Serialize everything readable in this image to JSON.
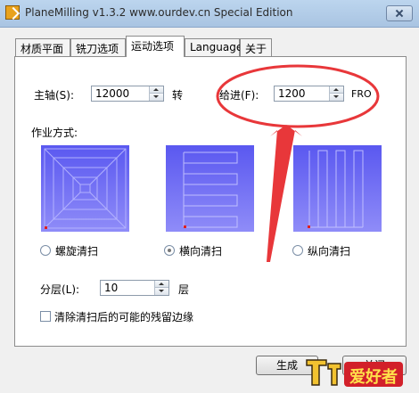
{
  "window": {
    "title": "PlaneMilling v1.3.2 www.ourdev.cn Special Edition"
  },
  "tabs": [
    {
      "label": "材质平面",
      "active": false
    },
    {
      "label": "铣刀选项",
      "active": false
    },
    {
      "label": "运动选项",
      "active": true
    },
    {
      "label": "Language",
      "active": false
    },
    {
      "label": "关于",
      "active": false
    }
  ],
  "spindle": {
    "label": "主轴(S):",
    "value": "12000",
    "unit": "转"
  },
  "feed": {
    "label": "给进(F):",
    "value": "1200",
    "unit": "FRO"
  },
  "mode": {
    "label": "作业方式:",
    "options": [
      {
        "label": "螺旋清扫",
        "selected": false
      },
      {
        "label": "横向清扫",
        "selected": true
      },
      {
        "label": "纵向清扫",
        "selected": false
      }
    ]
  },
  "layers": {
    "label": "分层(L):",
    "value": "10",
    "unit": "层"
  },
  "clear_edges": {
    "label": "清除清扫后的可能的残留边缘",
    "checked": false
  },
  "buttons": {
    "generate": "生成",
    "close": "关闭"
  },
  "watermark": {
    "text": "爱好者"
  },
  "colors": {
    "preview_top": "#5a58f0",
    "preview_bottom": "#8f8cf8",
    "annotation": "#e8373a"
  }
}
